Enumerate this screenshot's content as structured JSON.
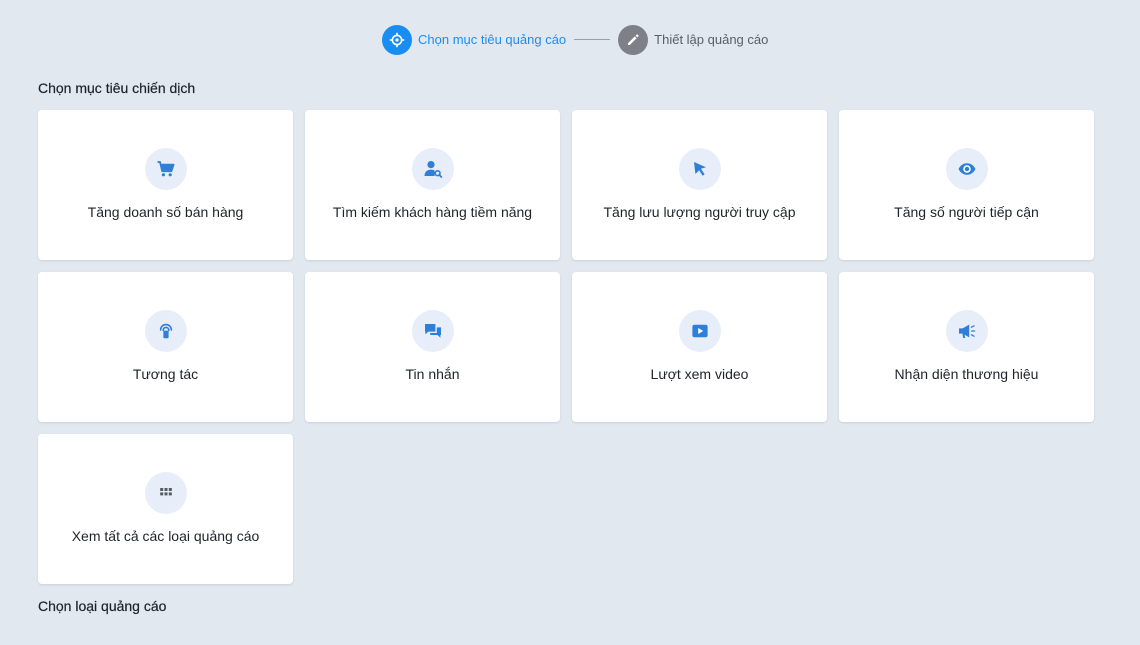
{
  "stepper": {
    "steps": [
      {
        "label": "Chọn mục tiêu quảng cáo",
        "icon": "crosshair-icon",
        "state": "active"
      },
      {
        "label": "Thiết lập quảng cáo",
        "icon": "pencil-icon",
        "state": "inactive"
      }
    ]
  },
  "objectives_section": {
    "title": "Chọn mục tiêu chiến dịch",
    "cards": [
      {
        "label": "Tăng doanh số bán hàng",
        "icon": "shopping-cart-icon"
      },
      {
        "label": "Tìm kiếm khách hàng tiềm năng",
        "icon": "user-search-icon"
      },
      {
        "label": "Tăng lưu lượng người truy cập",
        "icon": "cursor-arrow-icon"
      },
      {
        "label": "Tăng số người tiếp cận",
        "icon": "eye-icon"
      },
      {
        "label": "Tương tác",
        "icon": "touch-icon"
      },
      {
        "label": "Tin nhắn",
        "icon": "chat-bubbles-icon"
      },
      {
        "label": "Lượt xem video",
        "icon": "video-play-icon"
      },
      {
        "label": "Nhận diện thương hiệu",
        "icon": "megaphone-icon"
      },
      {
        "label": "Xem tất cả các loại quảng cáo",
        "icon": "grid-icon"
      }
    ]
  },
  "ad_types_section": {
    "title": "Chọn loại quảng cáo"
  },
  "colors": {
    "accent": "#1a8df2",
    "icon_blue": "#2f7fd8",
    "icon_gray": "#555b63",
    "background": "#e1e8f0",
    "card": "#ffffff",
    "inactive_step": "#7d8187"
  }
}
